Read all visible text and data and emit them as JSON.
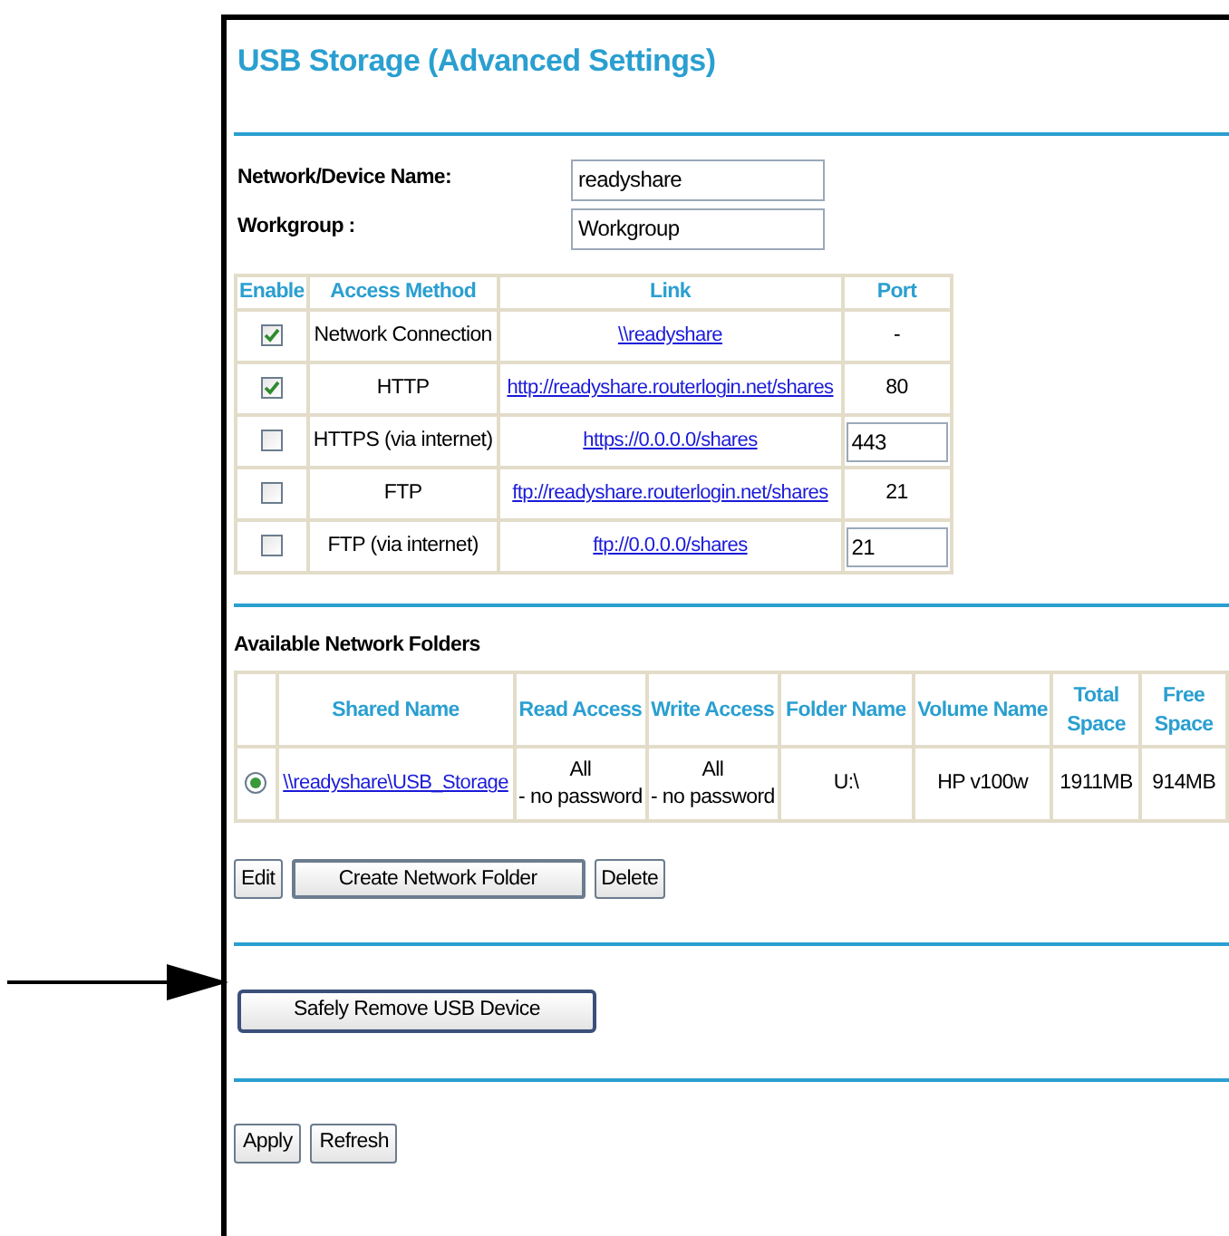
{
  "title": "USB Storage (Advanced Settings)",
  "fields": [
    {
      "label": "Network/Device Name:",
      "value": "readyshare"
    },
    {
      "label": "Workgroup :",
      "value": "Workgroup"
    }
  ],
  "access_table": {
    "columns": [
      "Enable",
      "Access Method",
      "Link",
      "Port"
    ],
    "rows": [
      {
        "checked": true,
        "method": "Network Connection",
        "link": "\\\\readyshare",
        "port": {
          "kind": "text",
          "value": "-"
        }
      },
      {
        "checked": true,
        "method": "HTTP",
        "link": "http://readyshare.routerlogin.net/shares",
        "port": {
          "kind": "text",
          "value": "80"
        }
      },
      {
        "checked": false,
        "method": "HTTPS (via internet)",
        "link": "https://0.0.0.0/shares",
        "port": {
          "kind": "input",
          "value": "443"
        }
      },
      {
        "checked": false,
        "method": "FTP",
        "link": "ftp://readyshare.routerlogin.net/shares",
        "port": {
          "kind": "text",
          "value": "21"
        }
      },
      {
        "checked": false,
        "method": "FTP (via internet)",
        "link": "ftp://0.0.0.0/shares",
        "port": {
          "kind": "input",
          "value": "21"
        }
      }
    ]
  },
  "folders_heading": "Available Network Folders",
  "folders_table": {
    "columns": [
      "",
      "Shared Name",
      "Read Access",
      "Write Access",
      "Folder Name",
      "Volume Name",
      "Total Space",
      "Free Space"
    ],
    "rows": [
      {
        "selected": true,
        "shared_name": "\\\\readyshare\\USB_Storage",
        "read_access": [
          "All",
          "- no password"
        ],
        "write_access": [
          "All",
          "- no password"
        ],
        "folder_name": "U:\\",
        "volume_name": "HP v100w",
        "total_space": "1911MB",
        "free_space": "914MB"
      }
    ]
  },
  "folder_buttons": [
    "Edit",
    "Create Network Folder",
    "Delete"
  ],
  "remove_button": "Safely Remove USB Device",
  "bottom_buttons": [
    "Apply",
    "Refresh"
  ]
}
